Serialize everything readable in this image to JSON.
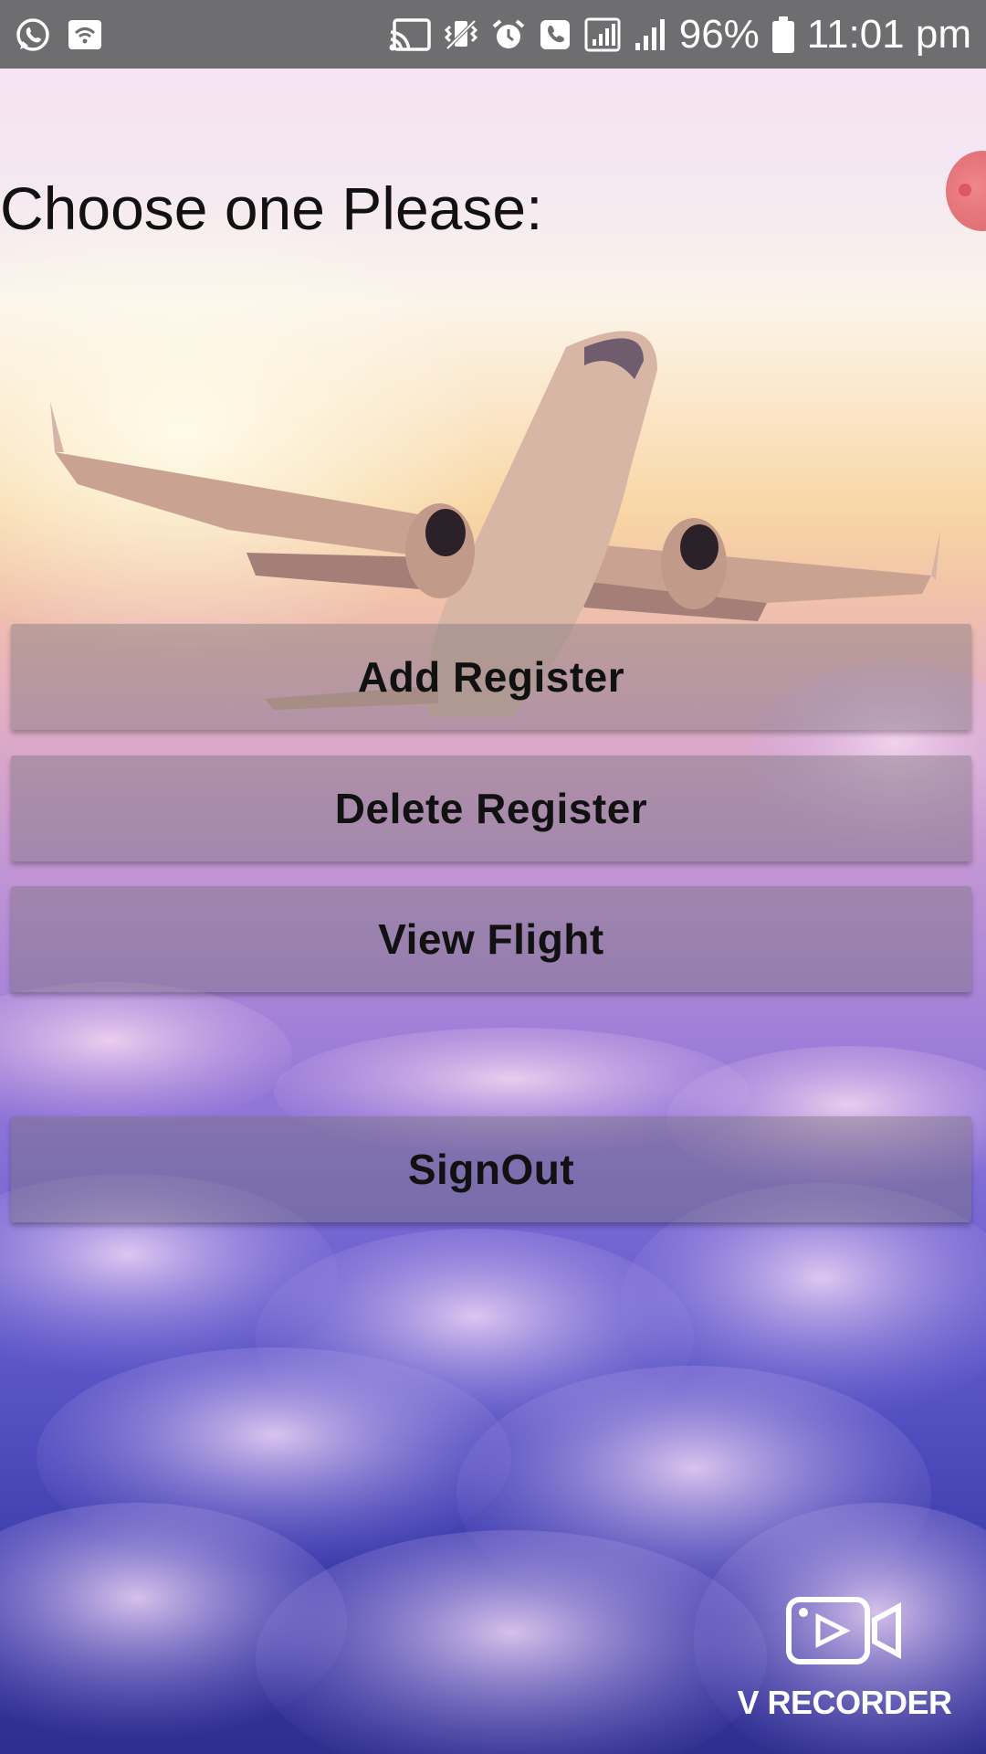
{
  "status_bar": {
    "left_icons": [
      "whatsapp-icon",
      "wifi-notification-icon"
    ],
    "right_icons": [
      "cast-icon",
      "vibrate-icon",
      "alarm-icon",
      "call-icon",
      "data-signal-icon",
      "cell-signal-icon",
      "battery-icon"
    ],
    "battery": "96%",
    "time": "11:01 pm"
  },
  "screen": {
    "prompt": "Choose one Please:",
    "buttons": [
      {
        "id": "add",
        "label": "Add Register"
      },
      {
        "id": "delete",
        "label": "Delete Register"
      },
      {
        "id": "view",
        "label": "View Flight"
      },
      {
        "id": "signout",
        "label": "SignOut"
      }
    ],
    "background_image": "airplane-over-clouds"
  },
  "overlay": {
    "floating_bubble_color": "#e35a5e",
    "watermark": "V RECORDER"
  }
}
